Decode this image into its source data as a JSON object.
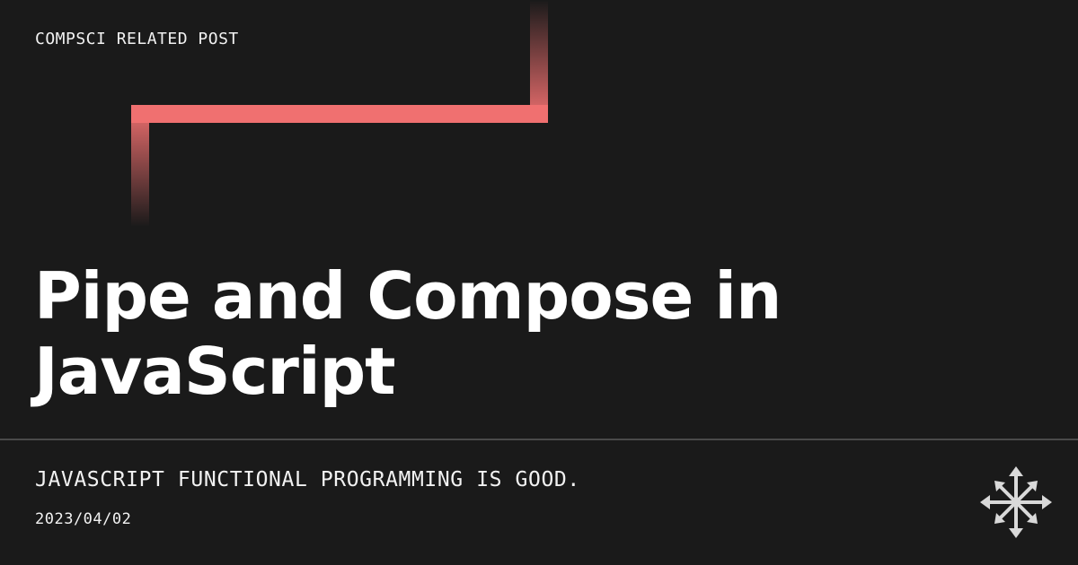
{
  "card": {
    "category": "COMPSCI RELATED POST",
    "title": "Pipe and Compose in JavaScript",
    "description": "JAVASCRIPT FUNCTIONAL PROGRAMMING IS GOOD.",
    "date": "2023/04/02"
  },
  "decoration": {
    "pipe_color": "#f07070",
    "logo_icon": "compass-arrows-icon",
    "logo_color": "#d9d9d9"
  },
  "colors": {
    "background": "#1a1a1a",
    "text": "#ffffff",
    "divider": "#4a4a4a"
  }
}
